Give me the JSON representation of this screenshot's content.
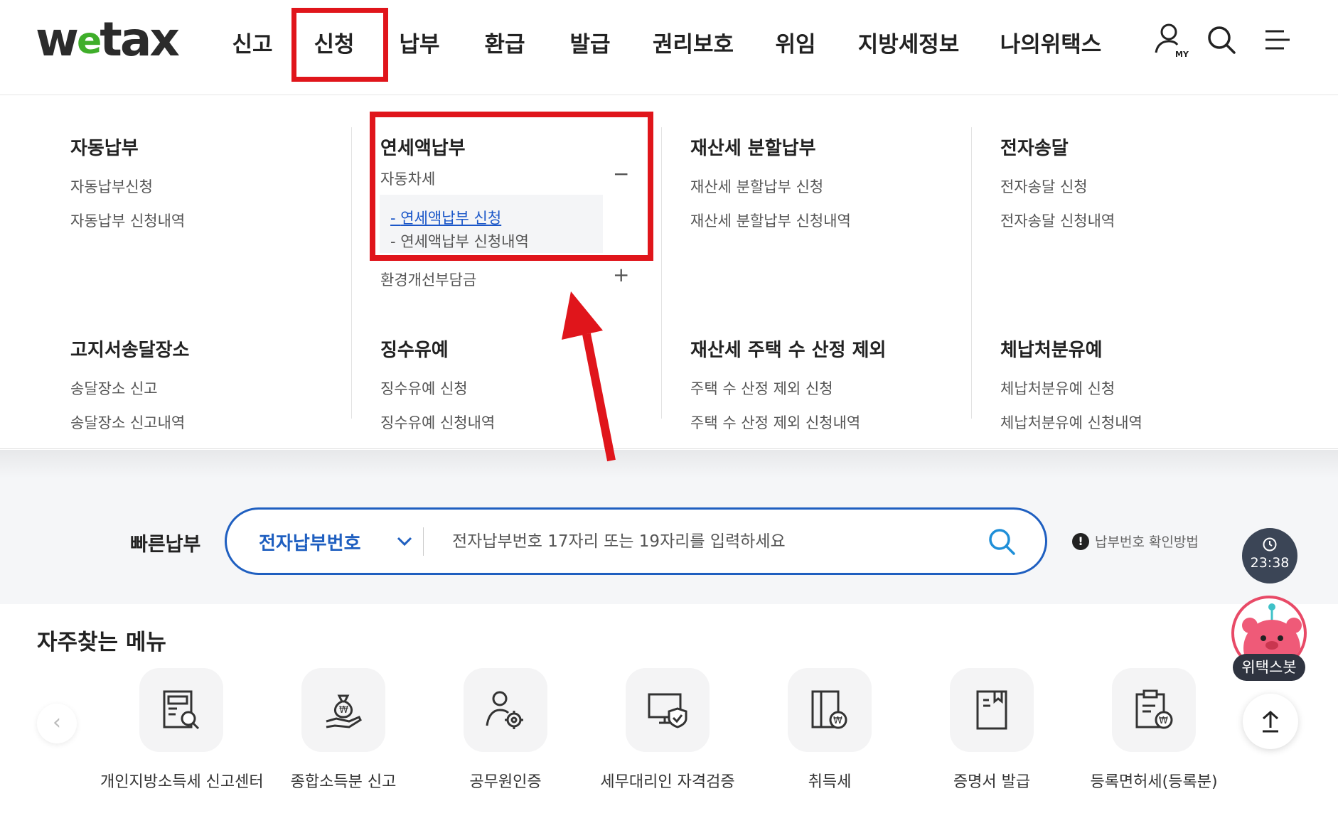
{
  "header": {
    "logo": {
      "before": "w",
      "e": "e",
      "after": "tax"
    },
    "nav": [
      "신고",
      "신청",
      "납부",
      "환급",
      "발급",
      "권리보호",
      "위임",
      "지방세정보",
      "나의위택스"
    ],
    "icons": [
      "my-page-icon",
      "search-icon",
      "menu-icon"
    ],
    "my_label": "MY"
  },
  "mega_menu": {
    "col1_top": {
      "title": "자동납부",
      "links": [
        "자동납부신청",
        "자동납부 신청내역"
      ]
    },
    "col2_top": {
      "title": "연세액납부",
      "accordion1": {
        "label": "자동차세",
        "sign": "−",
        "sub": [
          "연세액납부 신청",
          "연세액납부 신청내역"
        ]
      },
      "accordion2": {
        "label": "환경개선부담금",
        "sign": "+"
      }
    },
    "col3_top": {
      "title": "재산세 분할납부",
      "links": [
        "재산세 분할납부 신청",
        "재산세 분할납부 신청내역"
      ]
    },
    "col4_top": {
      "title": "전자송달",
      "links": [
        "전자송달 신청",
        "전자송달 신청내역"
      ]
    },
    "col1_bottom": {
      "title": "고지서송달장소",
      "links": [
        "송달장소 신고",
        "송달장소 신고내역"
      ]
    },
    "col2_bottom": {
      "title": "징수유예",
      "links": [
        "징수유예 신청",
        "징수유예 신청내역"
      ]
    },
    "col3_bottom": {
      "title": "재산세 주택 수 산정 제외",
      "links": [
        "주택 수 산정 제외 신청",
        "주택 수 산정 제외 신청내역"
      ]
    },
    "col4_bottom": {
      "title": "체납처분유예",
      "links": [
        "체납처분유예 신청",
        "체납처분유예 신청내역"
      ]
    }
  },
  "quick_pay": {
    "label": "빠른납부",
    "select_value": "전자납부번호",
    "placeholder": "전자납부번호 17자리 또는 19자리를 입력하세요",
    "help": "납부번호 확인방법",
    "help_mark": "!"
  },
  "favorites": {
    "title": "자주찾는 메뉴",
    "prev": "‹",
    "items": [
      {
        "label": "개인지방소득세 신고센터",
        "icon": "document-search-icon"
      },
      {
        "label": "종합소득분 신고",
        "icon": "money-bag-hand-icon"
      },
      {
        "label": "공무원인증",
        "icon": "officer-gear-icon"
      },
      {
        "label": "세무대리인 자격검증",
        "icon": "monitor-shield-icon"
      },
      {
        "label": "취득세",
        "icon": "property-won-icon"
      },
      {
        "label": "증명서 발급",
        "icon": "certificate-icon"
      },
      {
        "label": "등록면허세(등록분)",
        "icon": "clipboard-won-icon"
      }
    ]
  },
  "floating": {
    "clock": "23:38",
    "bot_label": "위택스봇",
    "top_icon": "arrow-up-icon"
  },
  "colors": {
    "accent_red": "#e0151b",
    "blue": "#1f5fc0",
    "logo_green": "#3fae2a"
  }
}
